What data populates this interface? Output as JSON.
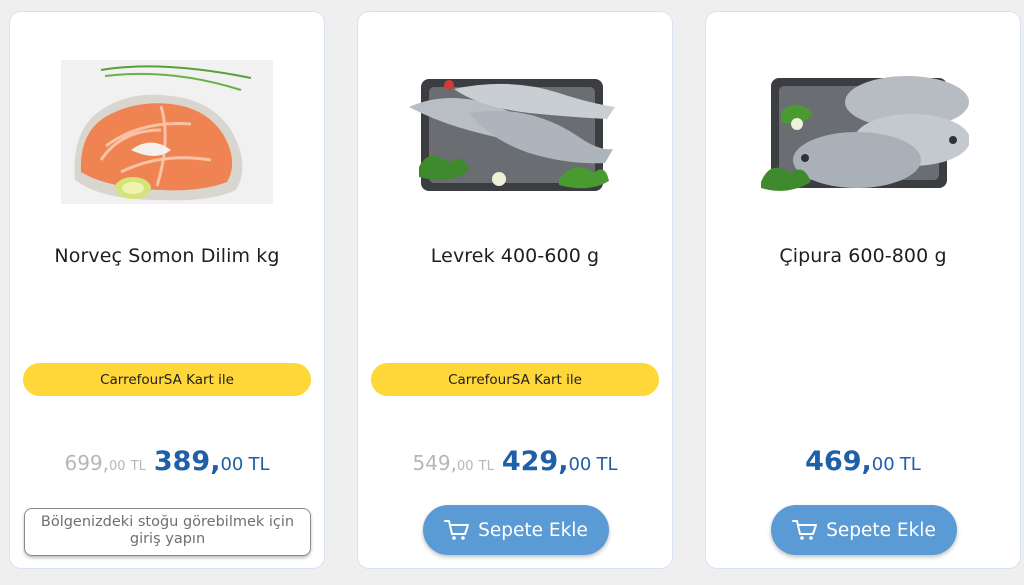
{
  "products": [
    {
      "name": "Norveç Somon Dilim kg",
      "badge": "CarrefourSA Kart ile",
      "old_price_int": "699,",
      "old_price_dec": "00",
      "old_price_cur": "TL",
      "price_int": "389,",
      "price_dec": "00",
      "price_cur": "TL",
      "action_label": "Bölgenizdeki stoğu görebilmek için giriş yapın",
      "image_icon": "salmon-steak-image"
    },
    {
      "name": "Levrek 400-600 g",
      "badge": "CarrefourSA Kart ile",
      "old_price_int": "549,",
      "old_price_dec": "00",
      "old_price_cur": "TL",
      "price_int": "429,",
      "price_dec": "00",
      "price_cur": "TL",
      "action_label": "Sepete Ekle",
      "image_icon": "sea-bass-tray-image"
    },
    {
      "name": "Çipura 600-800 g",
      "price_int": "469,",
      "price_dec": "00",
      "price_cur": "TL",
      "action_label": "Sepete Ekle",
      "image_icon": "sea-bream-tray-image"
    }
  ],
  "colors": {
    "badge_bg": "#ffd738",
    "price": "#1f5fa8",
    "old_price": "#b7b7b7",
    "cart_button": "#5b9bd5"
  },
  "icons": {
    "cart": "shopping-cart-icon"
  }
}
